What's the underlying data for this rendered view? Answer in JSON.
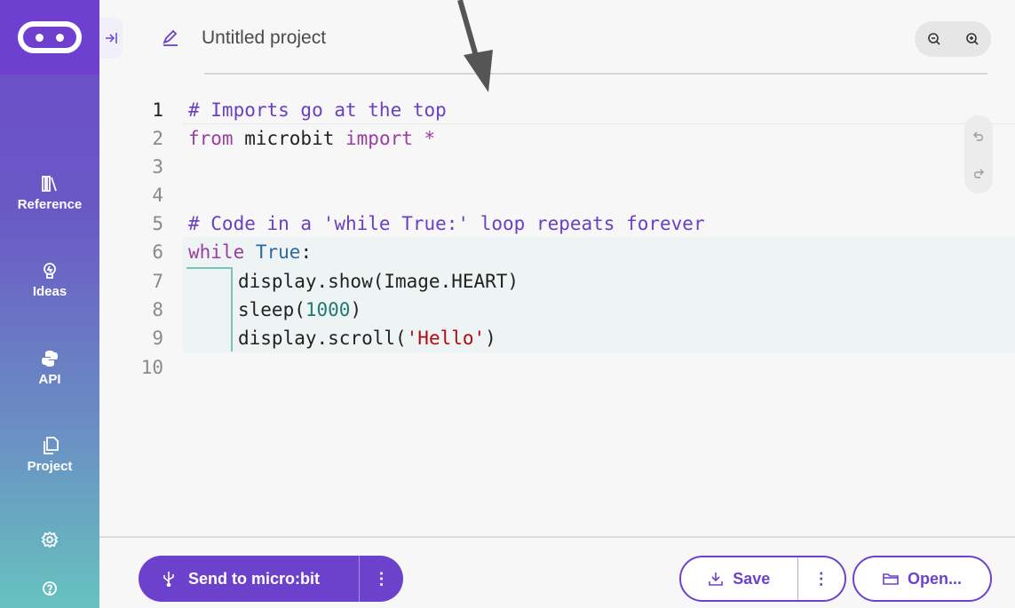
{
  "sidebar": {
    "logo": "microbit-logo",
    "items": [
      {
        "label": "Reference",
        "icon": "library-icon"
      },
      {
        "label": "Ideas",
        "icon": "lightbulb-icon"
      },
      {
        "label": "API",
        "icon": "python-icon"
      },
      {
        "label": "Project",
        "icon": "files-icon"
      }
    ],
    "settings_icon": "gear-icon",
    "help_icon": "help-icon"
  },
  "header": {
    "project_title": "Untitled project",
    "edit_icon": "pencil-icon",
    "zoom_out_icon": "zoom-out-icon",
    "zoom_in_icon": "zoom-in-icon"
  },
  "editor": {
    "line_numbers": [
      "1",
      "2",
      "3",
      "4",
      "5",
      "6",
      "7",
      "8",
      "9",
      "10"
    ],
    "active_line": 1,
    "lines": [
      {
        "parts": [
          {
            "t": "# Imports go at the top",
            "c": "cm"
          }
        ]
      },
      {
        "parts": [
          {
            "t": "from",
            "c": "kw"
          },
          {
            "t": " microbit ",
            "c": ""
          },
          {
            "t": "import",
            "c": "kw"
          },
          {
            "t": " *",
            "c": "kw"
          }
        ]
      },
      {
        "parts": []
      },
      {
        "parts": []
      },
      {
        "parts": [
          {
            "t": "# Code in a 'while True:' loop repeats forever",
            "c": "cm"
          }
        ]
      },
      {
        "parts": [
          {
            "t": "while",
            "c": "kw"
          },
          {
            "t": " ",
            "c": ""
          },
          {
            "t": "True",
            "c": "kw2"
          },
          {
            "t": ":",
            "c": ""
          }
        ]
      },
      {
        "parts": [
          {
            "t": "display.show(Image.HEART)",
            "c": ""
          }
        ]
      },
      {
        "parts": [
          {
            "t": "sleep(",
            "c": ""
          },
          {
            "t": "1000",
            "c": "num"
          },
          {
            "t": ")",
            "c": ""
          }
        ]
      },
      {
        "parts": [
          {
            "t": "display.scroll(",
            "c": ""
          },
          {
            "t": "'Hello'",
            "c": "str"
          },
          {
            "t": ")",
            "c": ""
          }
        ]
      },
      {
        "parts": []
      }
    ],
    "undo_icon": "undo-icon",
    "redo_icon": "redo-icon"
  },
  "footer": {
    "send_label": "Send to micro:bit",
    "send_icon": "usb-icon",
    "more_label": "⋮",
    "save_label": "Save",
    "save_icon": "download-icon",
    "open_label": "Open...",
    "open_icon": "folder-icon"
  },
  "colors": {
    "accent": "#6c42cc",
    "sidebar_top": "#6f3fd0",
    "sidebar_bottom": "#67c2bf"
  }
}
